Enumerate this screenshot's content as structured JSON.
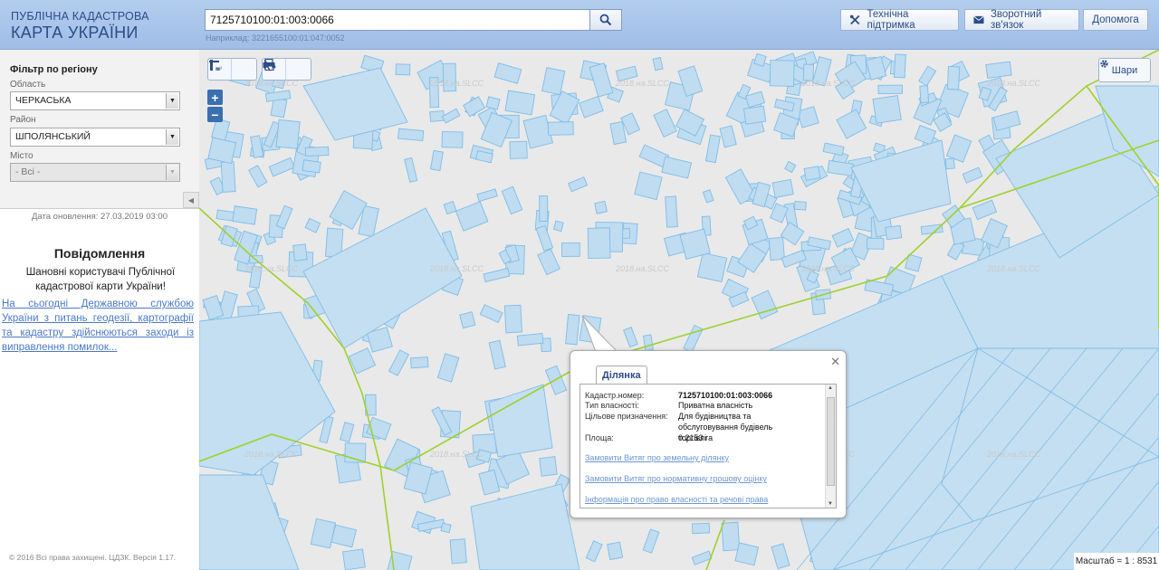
{
  "header": {
    "logo_line1": "ПУБЛІЧНА КАДАСТРОВА",
    "logo_line2": "КАРТА УКРАЇНИ",
    "search_value": "7125710100:01:003:0066",
    "example": "Наприклад: 3221655100:01:047:0052",
    "support_label": "Технічна підтримка",
    "feedback_label": "Зворотний зв'язок",
    "help_label": "Допомога"
  },
  "filter": {
    "title": "Фільтр по регіону",
    "oblast_label": "Область",
    "oblast_value": "ЧЕРКАСЬКА",
    "rayon_label": "Район",
    "rayon_value": "ШПОЛЯНСЬКИЙ",
    "misto_label": "Місто",
    "misto_value": "- Всі -"
  },
  "sidebar": {
    "update_date": "Дата оновлення: 27.03.2019 03:00",
    "notice_title": "Повідомлення",
    "notice_text": "Шановні користувачі Публічної кадастрової карти України!",
    "notice_link": "На сьогодні Державною службою України з питань геодезії, картографії та кадастру здійснюються заходи із виправлення помилок...",
    "copyright": "© 2016 Всі права захищені. ЦДЗК. Версія 1.17."
  },
  "map": {
    "layers_label": "Шари",
    "scale": "Масштаб = 1 : 8531",
    "watermark": "2018.на.SLCC",
    "tools": [
      "measure-distance",
      "measure-area",
      "print",
      "identify"
    ]
  },
  "popup": {
    "tab": "Ділянка",
    "rows": [
      {
        "key": "Кадастр.номер:",
        "value": "7125710100:01:003:0066"
      },
      {
        "key": "Тип власності:",
        "value": "Приватна власність"
      },
      {
        "key": "Цільове призначення:",
        "value": "Для будівництва та обслуговування будівель торгівлі"
      },
      {
        "key": "Площа:",
        "value": "0.2153 га"
      }
    ],
    "links": [
      "Замовити Витяг про земельну ділянку",
      "Замовити Витяг про нормативну грошову оцінку",
      "Інформація про право власності та речові права"
    ]
  },
  "colors": {
    "parcel_fill": "#bdd9ef",
    "parcel_stroke": "#7fbbe6",
    "boundary": "#9ccc2c",
    "header": "#a9c6ea"
  }
}
